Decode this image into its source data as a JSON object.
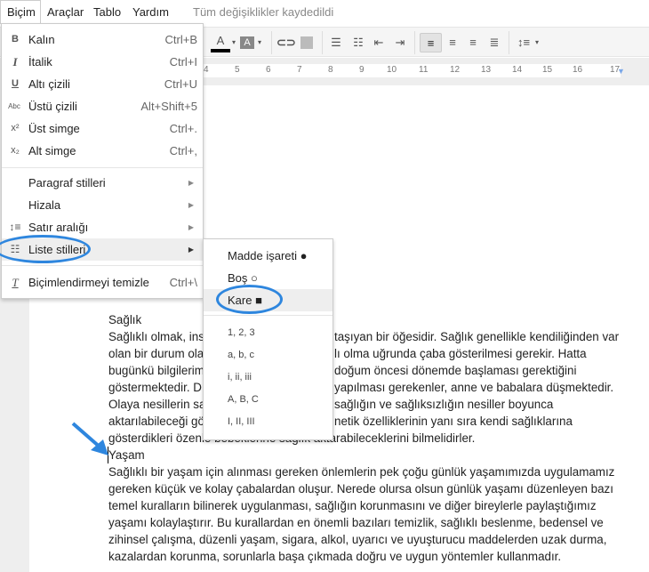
{
  "menubar": {
    "items": [
      "Biçim",
      "Araçlar",
      "Tablo",
      "Yardım"
    ],
    "status": "Tüm değişiklikler kaydedildi"
  },
  "ruler": {
    "ticks": [
      "4",
      "5",
      "6",
      "7",
      "8",
      "9",
      "10",
      "11",
      "12",
      "13",
      "14",
      "15",
      "16",
      "17"
    ]
  },
  "format_menu": {
    "items": [
      {
        "icon": "bold-icon",
        "glyph": "B",
        "label": "Kalın",
        "shortcut": "Ctrl+B"
      },
      {
        "icon": "italic-icon",
        "glyph": "I",
        "label": "İtalik",
        "shortcut": "Ctrl+I"
      },
      {
        "icon": "underline-icon",
        "glyph": "U",
        "label": "Altı çizili",
        "shortcut": "Ctrl+U"
      },
      {
        "icon": "strikethrough-icon",
        "glyph": "Abc",
        "label": "Üstü çizili",
        "shortcut": "Alt+Shift+5"
      },
      {
        "icon": "superscript-icon",
        "glyph": "x²",
        "label": "Üst simge",
        "shortcut": "Ctrl+."
      },
      {
        "icon": "subscript-icon",
        "glyph": "x₂",
        "label": "Alt simge",
        "shortcut": "Ctrl+,"
      }
    ],
    "sub_items": [
      "Paragraf stilleri",
      "Hizala",
      "Satır aralığı",
      "Liste stilleri"
    ],
    "clear": {
      "label": "Biçimlendirmeyi temizle",
      "shortcut": "Ctrl+\\"
    }
  },
  "list_styles_submenu": {
    "bullets": [
      "Madde işareti ●",
      "Boş ○",
      "Kare ■"
    ],
    "numbered": [
      "1, 2, 3",
      "a, b, c",
      "i, ii, iii",
      "A, B, C",
      "I, II, III"
    ],
    "selected": "Kare ■"
  },
  "document": {
    "heading1": "Sağlık",
    "para1": [
      [
        "Sağlıklı olmak, ins",
        "taşıyan bir öğesidir. Sağlık genellikle kendiliğinden var"
      ],
      [
        "olan bir durum ola",
        "lı olma uğrunda çaba gösterilmesi gerekir. Hatta"
      ],
      [
        "bugünkü bilgilerim",
        "doğum öncesi dönemde başlaması gerektiğini"
      ],
      [
        "göstermektedir. D",
        "yapılması gerekenler, anne ve babalara düşmektedir."
      ],
      [
        "Olaya nesillerin sa",
        "sağlığın ve sağlıksızlığın nesiller boyunca"
      ],
      [
        "aktarılabileceği gö",
        "netik özelliklerinin yanı sıra kendi sağlıklarına"
      ],
      [
        "gösterdikleri özenle bebeklerine sağlık aktarabileceklerini bilmelidirler.",
        ""
      ]
    ],
    "heading2": "Yaşam",
    "para2": [
      "Sağlıklı bir yaşam için alınması gereken önlemlerin pek çoğu günlük yaşamımızda  uygulamamız",
      "gereken küçük ve kolay çabalardan oluşur. Nerede olursa olsun günlük yaşamı düzenleyen bazı",
      "temel kuralların bilinerek uygulanması, sağlığın korunmasını ve diğer bireylerle paylaştığımız",
      "yaşamı kolaylaştırır. Bu kurallardan en önemli bazıları temizlik, sağlıklı beslenme, bedensel ve",
      "zihinsel çalışma, düzenli yaşam, sigara, alkol, uyarıcı ve uyuşturucu maddelerden uzak durma,",
      "kazalardan korunma, sorunlarla başa çıkmada doğru ve uygun yöntemler kullanmadır."
    ]
  },
  "colors": {
    "annotation": "#2e86de",
    "menu_highlight": "#eeeeee"
  }
}
